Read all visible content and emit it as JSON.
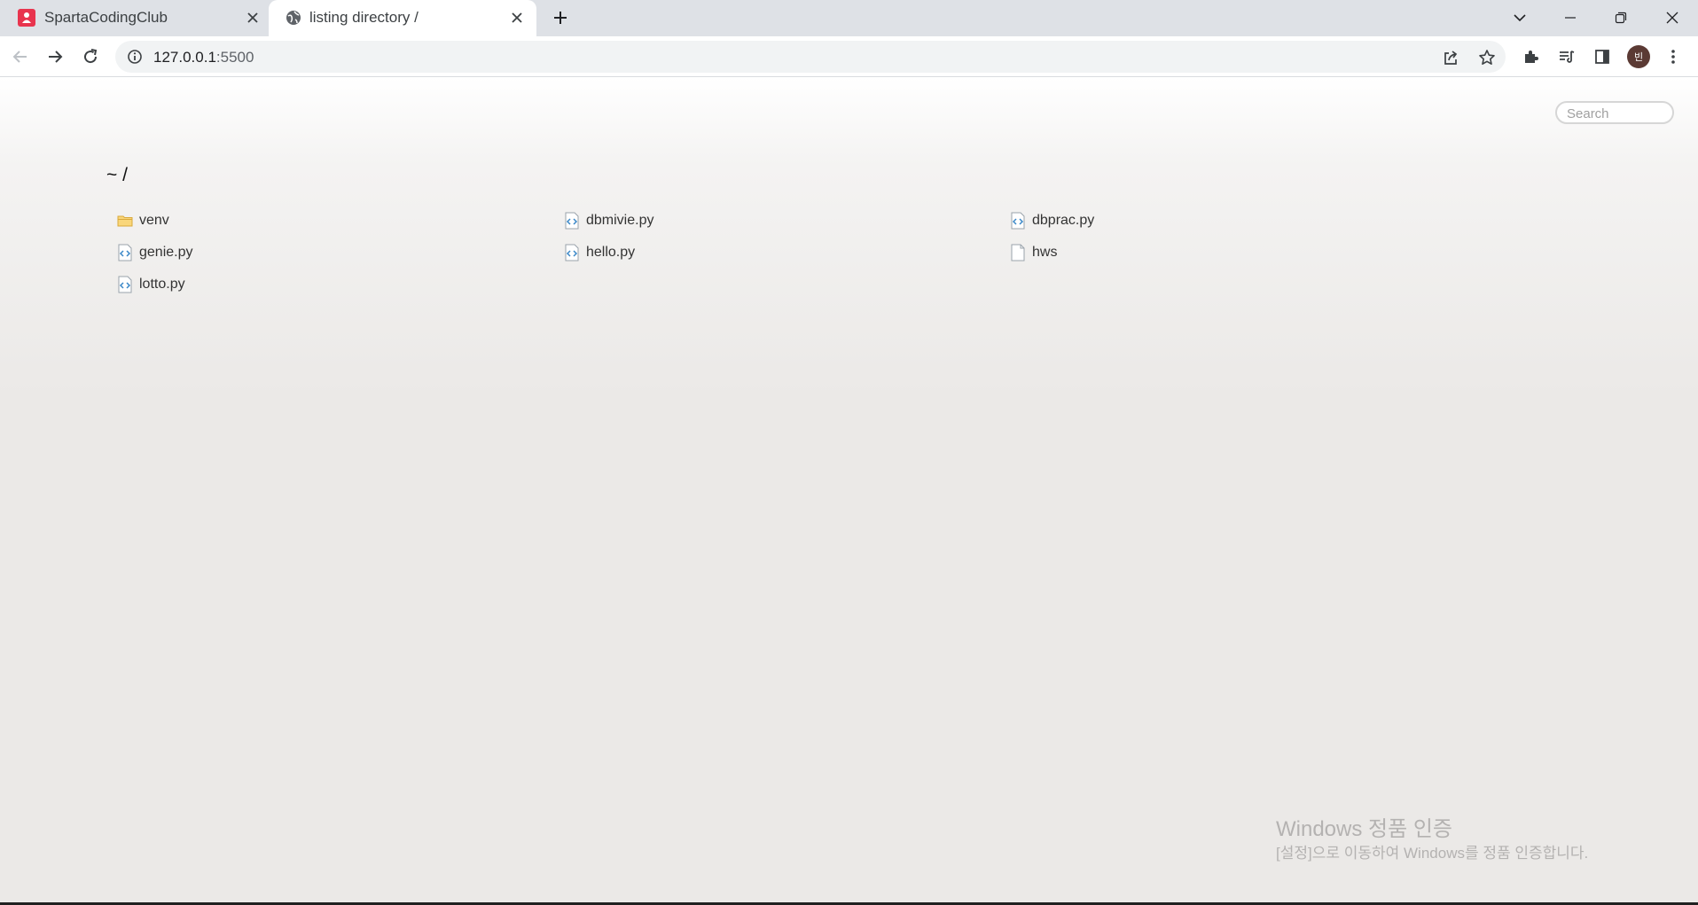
{
  "browser": {
    "tabs": [
      {
        "title": "SpartaCodingClub",
        "active": false,
        "favicon": "spartacodingclub-logo-icon"
      },
      {
        "title": "listing directory /",
        "active": true,
        "favicon": "globe-icon"
      }
    ],
    "new_tab_icon": "plus-icon",
    "window_controls": [
      "tab-search-icon",
      "minimize-icon",
      "restore-icon",
      "close-icon"
    ],
    "address_bar": {
      "host": "127.0.0.1",
      "port": ":5500",
      "site_info_icon": "info-icon"
    },
    "toolbar_icons": [
      "share-icon",
      "bookmark-star-icon",
      "extensions-icon",
      "reading-list-icon",
      "side-panel-icon",
      "more-menu-icon"
    ],
    "profile_initial": "빈",
    "accent_colors": {
      "tab_strip": "#dee1e6",
      "profile": "#5b3a34",
      "sparta_red": "#e8344e"
    }
  },
  "page": {
    "search_placeholder": "Search",
    "heading": "~ /",
    "files": [
      {
        "name": "venv",
        "type": "folder"
      },
      {
        "name": "dbmivie.py",
        "type": "code"
      },
      {
        "name": "dbprac.py",
        "type": "code"
      },
      {
        "name": "genie.py",
        "type": "code"
      },
      {
        "name": "hello.py",
        "type": "code"
      },
      {
        "name": "hws",
        "type": "file"
      },
      {
        "name": "lotto.py",
        "type": "code"
      }
    ]
  },
  "watermark": {
    "line1": "Windows 정품 인증",
    "line2": "[설정]으로 이동하여 Windows를 정품 인증합니다."
  }
}
